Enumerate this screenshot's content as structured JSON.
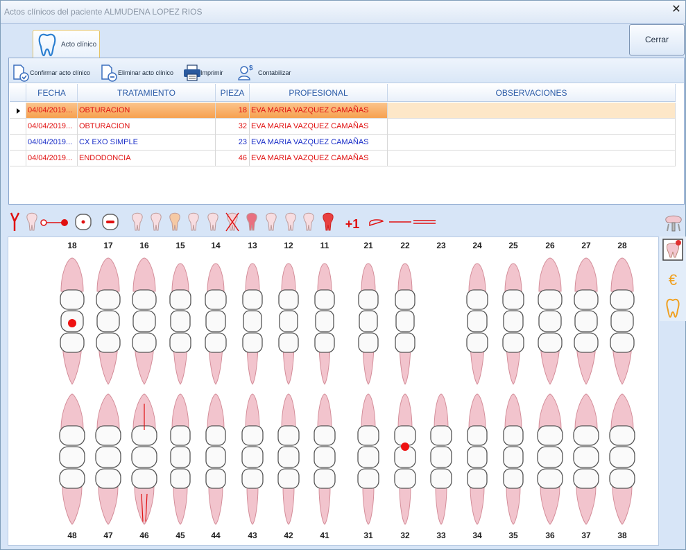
{
  "window": {
    "title": "Actos clínicos del paciente ALMUDENA LOPEZ RIOS",
    "close_glyph": "✕"
  },
  "tab": {
    "label": "Acto clínico",
    "icon": "tooth-icon"
  },
  "cerrar_label": "Cerrar",
  "toolbar": {
    "confirmar": "Confirmar acto clínico",
    "eliminar": "Eliminar acto clínico",
    "imprimir": "Imprimir",
    "contabilizar": "Contabilizar"
  },
  "grid": {
    "headers": [
      "FECHA",
      "TRATAMIENTO",
      "PIEZA",
      "PROFESIONAL",
      "OBSERVACIONES"
    ],
    "rows": [
      {
        "fecha": "04/04/2019...",
        "tratamiento": "OBTURACION",
        "pieza": "18",
        "profesional": "EVA MARIA VAZQUEZ CAMAÑAS",
        "observaciones": "",
        "color": "#e01010",
        "selected": true
      },
      {
        "fecha": "04/04/2019...",
        "tratamiento": "OBTURACION",
        "pieza": "32",
        "profesional": "EVA MARIA VAZQUEZ CAMAÑAS",
        "observaciones": "",
        "color": "#e01010",
        "selected": false
      },
      {
        "fecha": "04/04/2019...",
        "tratamiento": "CX EXO SIMPLE",
        "pieza": "23",
        "profesional": "EVA MARIA VAZQUEZ CAMAÑAS",
        "observaciones": "",
        "color": "#1a2ec8",
        "selected": false
      },
      {
        "fecha": "04/04/2019...",
        "tratamiento": "ENDODONCIA",
        "pieza": "46",
        "profesional": "EVA MARIA VAZQUEZ CAMAÑAS",
        "observaciones": "",
        "color": "#e01010",
        "selected": false
      }
    ]
  },
  "odonto_tools": {
    "plus_one": "+1",
    "icons": [
      "y-root-icon",
      "tooth-icon",
      "probe-icon",
      "occlusal-dot-icon",
      "occlusal-bar-icon",
      "tooth-icon",
      "tooth-icon",
      "tooth-icon",
      "tooth-icon",
      "tooth-icon",
      "extracted-tooth-icon",
      "tooth-icon",
      "tooth-icon",
      "tooth-icon",
      "tooth-icon",
      "red-tooth-icon",
      "plus-one-icon",
      "half-tooth-icon",
      "line-icon",
      "double-line-icon"
    ]
  },
  "side_tools": {
    "euro": "€",
    "icons": [
      "implant-icon",
      "tooth-select-icon",
      "euro-icon",
      "tooth-outline-icon"
    ]
  },
  "teeth": {
    "upper": [
      "18",
      "17",
      "16",
      "15",
      "14",
      "13",
      "12",
      "11",
      "21",
      "22",
      "23",
      "24",
      "25",
      "26",
      "27",
      "28"
    ],
    "lower": [
      "48",
      "47",
      "46",
      "45",
      "44",
      "43",
      "42",
      "41",
      "31",
      "32",
      "33",
      "34",
      "35",
      "36",
      "37",
      "38"
    ]
  },
  "colors": {
    "selected_row": "#f6a14f",
    "red": "#e01010",
    "blue": "#1a2ec8",
    "accent": "#2d5da8"
  }
}
